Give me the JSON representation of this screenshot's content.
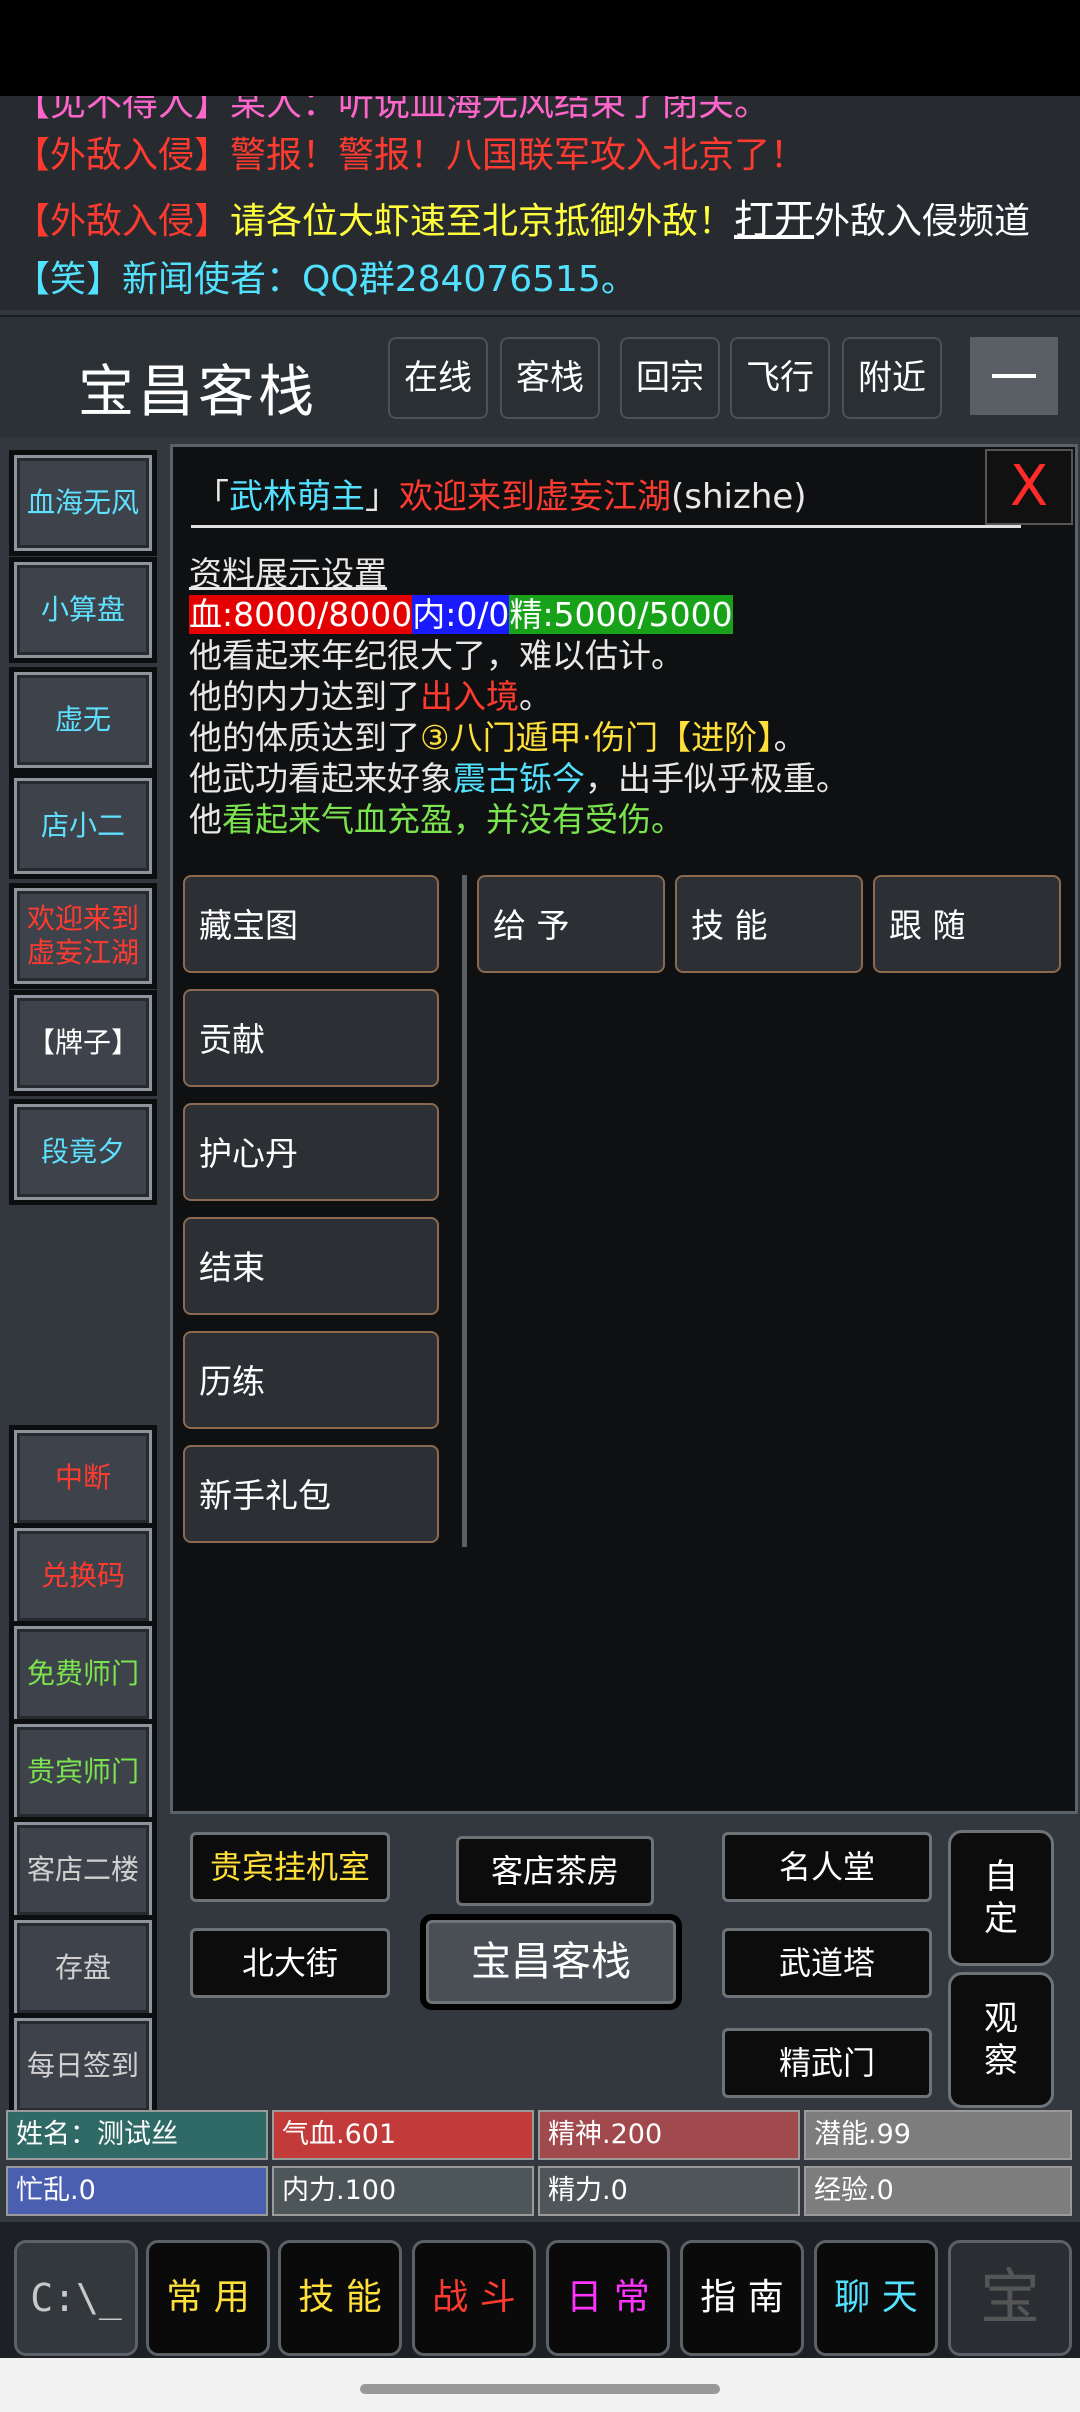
{
  "chat": {
    "cut_line": "【见不得人】某人：听说血海无风结束了閉关。",
    "line1": {
      "tag": "【外敌入侵】",
      "text": "警报！警报！八国联军攻入北京了！"
    },
    "line2": {
      "tag": "【外敌入侵】",
      "text": "请各位大虾速至北京抵御外敌！",
      "link": "打开",
      "tail": "外敌入侵频道"
    },
    "line3": {
      "tag": "【笑】",
      "text": "新闻使者：QQ群284076515。"
    }
  },
  "header": {
    "location": "宝昌客栈",
    "nav": [
      "在线",
      "客栈",
      "回宗",
      "飞行",
      "附近"
    ],
    "collapse_label": "—"
  },
  "side_top": [
    {
      "label": "血海无风",
      "color": "#5ee0ff"
    },
    {
      "label": "小算盘",
      "color": "#5ee0ff"
    },
    {
      "label": "虚无",
      "color": "#5ee0ff"
    },
    {
      "label": "店小二",
      "color": "#5ee0ff"
    },
    {
      "label": "欢迎来到虚妄江湖",
      "color": "#ff3b30"
    },
    {
      "label": "【牌子】",
      "color": "#ffffff"
    },
    {
      "label": "段竟夕",
      "color": "#5ee0ff"
    }
  ],
  "side_bottom": [
    {
      "label": "中断",
      "color": "#ff3b30"
    },
    {
      "label": "兑换码",
      "color": "#ff3b30"
    },
    {
      "label": "免费师门",
      "color": "#7be34d"
    },
    {
      "label": "贵宾师门",
      "color": "#7be34d"
    },
    {
      "label": "客店二楼",
      "color": "#d0d0d0"
    },
    {
      "label": "存盘",
      "color": "#d0d0d0"
    },
    {
      "label": "每日签到",
      "color": "#d0d0d0"
    }
  ],
  "panel": {
    "title_prefix": "「",
    "title_rank": "武林萌主",
    "title_suffix": "」",
    "welcome": "欢迎来到虚妄江湖",
    "player_id": "(shizhe)",
    "close_label": "X",
    "rule": "——————————————————————————",
    "settings_link": "资料展示设置",
    "hp": "血:8000/8000",
    "mp": "内:0/0",
    "jing": "精:5000/5000",
    "desc1": "他看起来年纪很大了，难以估计。",
    "desc2_pre": "他的内力达到了",
    "desc2_val": "出入境",
    "desc2_post": "。",
    "desc3_pre": "他的体质达到了",
    "desc3_val": "③八门遁甲·伤门【进阶】",
    "desc3_post": "。",
    "desc4_pre": "他武功看起来好象",
    "desc4_val": "震古铄今",
    "desc4_post": "，出手似乎极重。",
    "desc5_pre": "他",
    "desc5_val": "看起来气血充盈，并没有受伤。",
    "left_actions": [
      "藏宝图",
      "贡献",
      "护心丹",
      "结束",
      "历练",
      "新手礼包"
    ],
    "right_actions": [
      "给 予",
      "技 能",
      "跟 随"
    ]
  },
  "map": {
    "vip_room": "贵宾挂机室",
    "tea_room": "客店茶房",
    "hall_of_fame": "名人堂",
    "north_street": "北大街",
    "current": "宝昌客栈",
    "tower": "武道塔",
    "jingwu": "精武门",
    "custom": "自定",
    "observe": "观察"
  },
  "stats": {
    "name": "姓名：测试丝",
    "qixue": "气血.601",
    "jingshen": "精神.200",
    "qianneng": "潜能.99",
    "mangluan": "忙乱.0",
    "neili": "内力.100",
    "jingli": "精力.0",
    "jingyan": "经验.0"
  },
  "tabs": {
    "console": "C:\\_",
    "common": "常 用",
    "skills": "技 能",
    "battle": "战 斗",
    "daily": "日 常",
    "guide": "指 南",
    "chat": "聊 天",
    "last": "宝"
  }
}
